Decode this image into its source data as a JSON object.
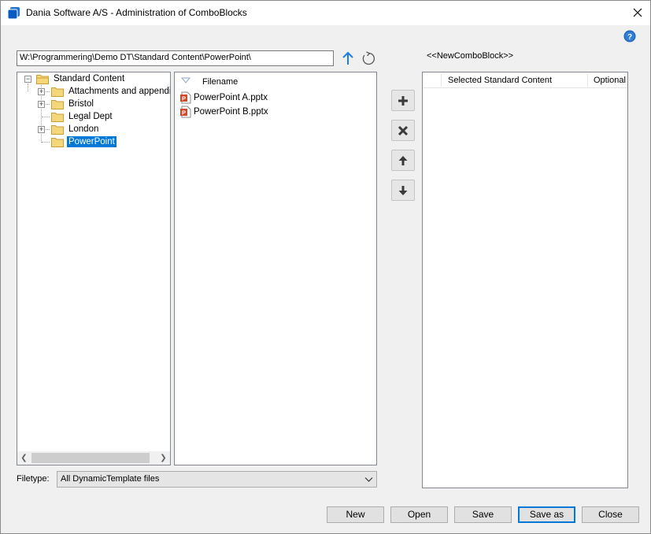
{
  "window": {
    "title": "Dania Software A/S - Administration of ComboBlocks"
  },
  "icons": {
    "app": "app-icon",
    "close": "close-icon",
    "help": "help-icon",
    "up": "arrow-up-icon",
    "refresh": "refresh-icon"
  },
  "path": {
    "value": "W:\\Programmering\\Demo DT\\Standard Content\\PowerPoint\\"
  },
  "combo": {
    "name": "<<NewComboBlock>>"
  },
  "tree": {
    "root": "Standard Content",
    "items": [
      {
        "label": "Attachments and appendices",
        "expandable": true
      },
      {
        "label": "Bristol",
        "expandable": true
      },
      {
        "label": "Legal Dept",
        "expandable": false
      },
      {
        "label": "London",
        "expandable": true
      },
      {
        "label": "PowerPoint",
        "expandable": false,
        "selected": true
      }
    ]
  },
  "files": {
    "header": "Filename",
    "items": [
      "PowerPoint A.pptx",
      "PowerPoint B.pptx"
    ]
  },
  "side_buttons": [
    "add-icon",
    "remove-icon",
    "move-up-icon",
    "move-down-icon"
  ],
  "selected": {
    "col_content": "Selected Standard Content",
    "col_optional": "Optional"
  },
  "filetype": {
    "label": "Filetype:",
    "value": "All DynamicTemplate files"
  },
  "buttons": {
    "new": "New",
    "open": "Open",
    "save": "Save",
    "save_as": "Save as",
    "close": "Close"
  },
  "colors": {
    "accent": "#0078d7",
    "folder": "#e8c25a",
    "ppt": "#d24726"
  }
}
